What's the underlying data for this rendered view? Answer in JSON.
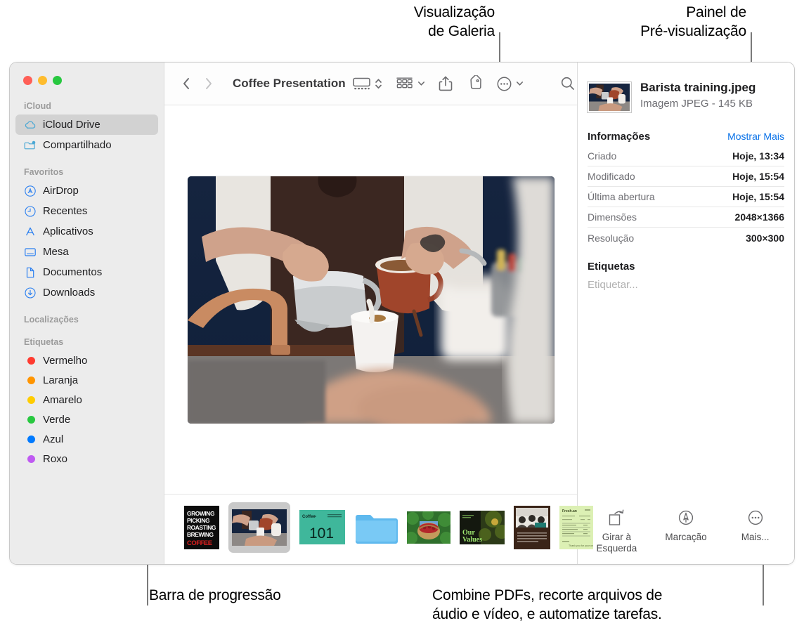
{
  "annotations": {
    "gallery_view": "Visualização\nde Galeria",
    "gallery_view_l1": "Visualização",
    "gallery_view_l2": "de Galeria",
    "preview_panel_l1": "Painel de",
    "preview_panel_l2": "Pré-visualização",
    "progress_bar": "Barra de progressão",
    "bottom_right_l1": "Combine PDFs, recorte arquivos de",
    "bottom_right_l2": "áudio e vídeo, e automatize tarefas."
  },
  "window": {
    "title": "Coffee Presentation",
    "traffic_lights": [
      "close-button",
      "minimize-button",
      "zoom-button"
    ]
  },
  "sidebar": {
    "sections": [
      {
        "header": "iCloud",
        "items": [
          {
            "label": "iCloud Drive",
            "icon": "icloud-icon",
            "selected": true
          },
          {
            "label": "Compartilhado",
            "icon": "shared-folder-icon",
            "selected": false
          }
        ]
      },
      {
        "header": "Favoritos",
        "items": [
          {
            "label": "AirDrop",
            "icon": "airdrop-icon",
            "selected": false
          },
          {
            "label": "Recentes",
            "icon": "clock-icon",
            "selected": false
          },
          {
            "label": "Aplicativos",
            "icon": "applications-icon",
            "selected": false
          },
          {
            "label": "Mesa",
            "icon": "desktop-icon",
            "selected": false
          },
          {
            "label": "Documentos",
            "icon": "document-icon",
            "selected": false
          },
          {
            "label": "Downloads",
            "icon": "downloads-icon",
            "selected": false
          }
        ]
      },
      {
        "header": "Localizações",
        "items": []
      },
      {
        "header": "Etiquetas",
        "items": [
          {
            "label": "Vermelho",
            "icon": "tag-dot-icon",
            "color": "#ff3b30"
          },
          {
            "label": "Laranja",
            "icon": "tag-dot-icon",
            "color": "#ff9500"
          },
          {
            "label": "Amarelo",
            "icon": "tag-dot-icon",
            "color": "#ffcc00"
          },
          {
            "label": "Verde",
            "icon": "tag-dot-icon",
            "color": "#28c840"
          },
          {
            "label": "Azul",
            "icon": "tag-dot-icon",
            "color": "#007aff"
          },
          {
            "label": "Roxo",
            "icon": "tag-dot-icon",
            "color": "#bf5af2"
          }
        ]
      }
    ]
  },
  "toolbar": {
    "back": "back-arrow",
    "forward": "forward-arrow",
    "view_gallery": "gallery-view-icon",
    "view_stepper": "view-stepper-icon",
    "group_by": "group-by-icon",
    "share": "share-icon",
    "tag": "tag-icon",
    "more": "more-actions-icon",
    "search": "search-icon"
  },
  "gallery": {
    "hero_alt": "barista-pouring-coffee",
    "thumbnails": [
      {
        "name": "coffee-poster-thumb",
        "kind": "poster",
        "text": [
          "GROWING",
          "PICKING",
          "ROASTING",
          "BREWING",
          "COFFEE"
        ],
        "selected": false
      },
      {
        "name": "barista-training-thumb",
        "kind": "photo",
        "selected": true
      },
      {
        "name": "coffee-101-thumb",
        "kind": "slide",
        "text": "101",
        "label": "Coffee",
        "selected": false
      },
      {
        "name": "folder-thumb",
        "kind": "folder",
        "selected": false
      },
      {
        "name": "berries-basket-thumb",
        "kind": "photo",
        "selected": false
      },
      {
        "name": "our-values-thumb",
        "kind": "slide",
        "text": "Our\nValues",
        "selected": false
      },
      {
        "name": "meeting-photo-thumb",
        "kind": "document",
        "selected": false
      },
      {
        "name": "invoice-thumb",
        "kind": "document",
        "selected": false
      }
    ]
  },
  "preview": {
    "file_name": "Barista training.jpeg",
    "file_kind": "Imagem JPEG - 145 KB",
    "info_title": "Informações",
    "show_more": "Mostrar Mais",
    "info": [
      {
        "key": "Criado",
        "value": "Hoje, 13:34"
      },
      {
        "key": "Modificado",
        "value": "Hoje, 15:54"
      },
      {
        "key": "Última abertura",
        "value": "Hoje, 15:54"
      },
      {
        "key": "Dimensões",
        "value": "2048×1366"
      },
      {
        "key": "Resolução",
        "value": "300×300"
      }
    ],
    "tags_title": "Etiquetas",
    "tags_placeholder": "Etiquetar...",
    "actions": [
      {
        "label": "Girar à\nEsquerda",
        "icon": "rotate-left-icon"
      },
      {
        "label": "Marcação",
        "icon": "markup-icon"
      },
      {
        "label": "Mais...",
        "icon": "more-circle-icon"
      }
    ],
    "action_0_l1": "Girar à",
    "action_0_l2": "Esquerda",
    "action_1_label": "Marcação",
    "action_2_label": "Mais..."
  },
  "colors": {
    "accent": "#0a72e8",
    "sidebar_bg": "#ececec",
    "selected_row": "#d2d2d2"
  }
}
